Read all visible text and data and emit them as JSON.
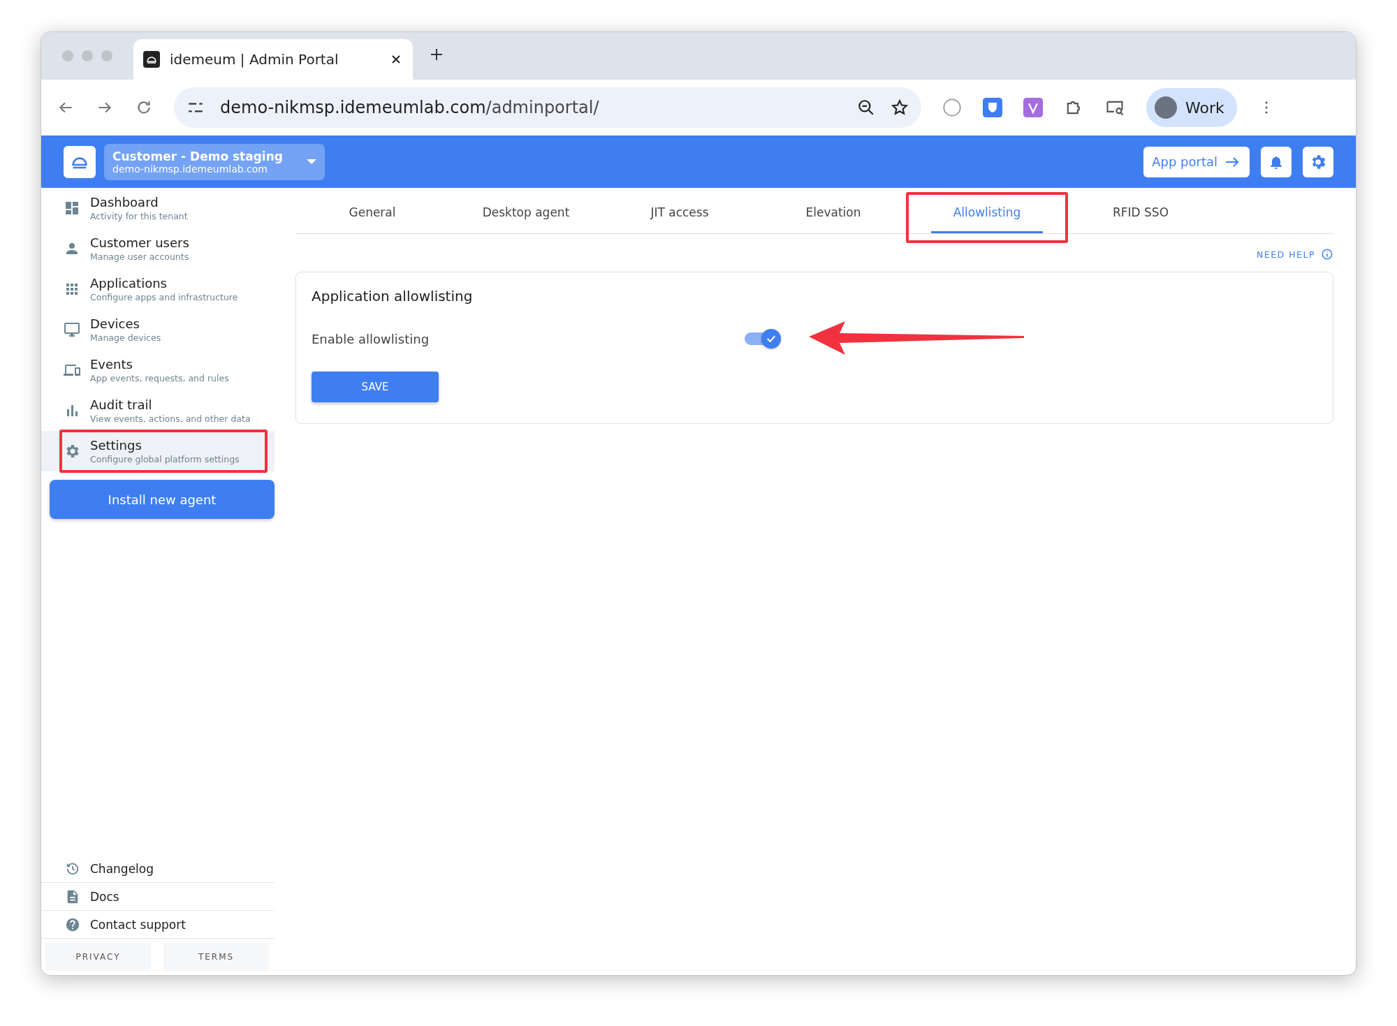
{
  "browser": {
    "tab_title": "idemeum | Admin Portal",
    "url_host": "demo-nikmsp.idemeumlab.com",
    "url_path": "/adminportal/",
    "profile": "Work"
  },
  "header": {
    "tenant_name": "Customer - Demo staging",
    "tenant_domain": "demo-nikmsp.idemeumlab.com",
    "app_portal": "App portal"
  },
  "sidebar": {
    "items": [
      {
        "kind": "dashboard",
        "title": "Dashboard",
        "subtitle": "Activity for this tenant",
        "selected": false,
        "annotated": false
      },
      {
        "kind": "users",
        "title": "Customer users",
        "subtitle": "Manage user accounts",
        "selected": false,
        "annotated": false
      },
      {
        "kind": "apps",
        "title": "Applications",
        "subtitle": "Configure apps and infrastructure",
        "selected": false,
        "annotated": false
      },
      {
        "kind": "devices",
        "title": "Devices",
        "subtitle": "Manage devices",
        "selected": false,
        "annotated": false
      },
      {
        "kind": "events",
        "title": "Events",
        "subtitle": "App events, requests, and rules",
        "selected": false,
        "annotated": false
      },
      {
        "kind": "audit",
        "title": "Audit trail",
        "subtitle": "View events, actions, and other data",
        "selected": false,
        "annotated": false
      },
      {
        "kind": "settings",
        "title": "Settings",
        "subtitle": "Configure global platform settings",
        "selected": true,
        "annotated": true
      }
    ],
    "install_button": "Install new agent",
    "links": [
      {
        "kind": "changelog",
        "label": "Changelog"
      },
      {
        "kind": "docs",
        "label": "Docs"
      },
      {
        "kind": "support",
        "label": "Contact support"
      }
    ],
    "legal": [
      "PRIVACY",
      "TERMS"
    ]
  },
  "tabs": [
    {
      "label": "General",
      "selected": false,
      "annotated": false
    },
    {
      "label": "Desktop agent",
      "selected": false,
      "annotated": false
    },
    {
      "label": "JIT access",
      "selected": false,
      "annotated": false
    },
    {
      "label": "Elevation",
      "selected": false,
      "annotated": false
    },
    {
      "label": "Allowlisting",
      "selected": true,
      "annotated": true
    },
    {
      "label": "RFID SSO",
      "selected": false,
      "annotated": false
    }
  ],
  "need_help": "NEED HELP",
  "card": {
    "title": "Application allowlisting",
    "setting": {
      "label": "Enable allowlisting",
      "on": true
    },
    "save": "SAVE"
  },
  "annotation_arrow": true
}
